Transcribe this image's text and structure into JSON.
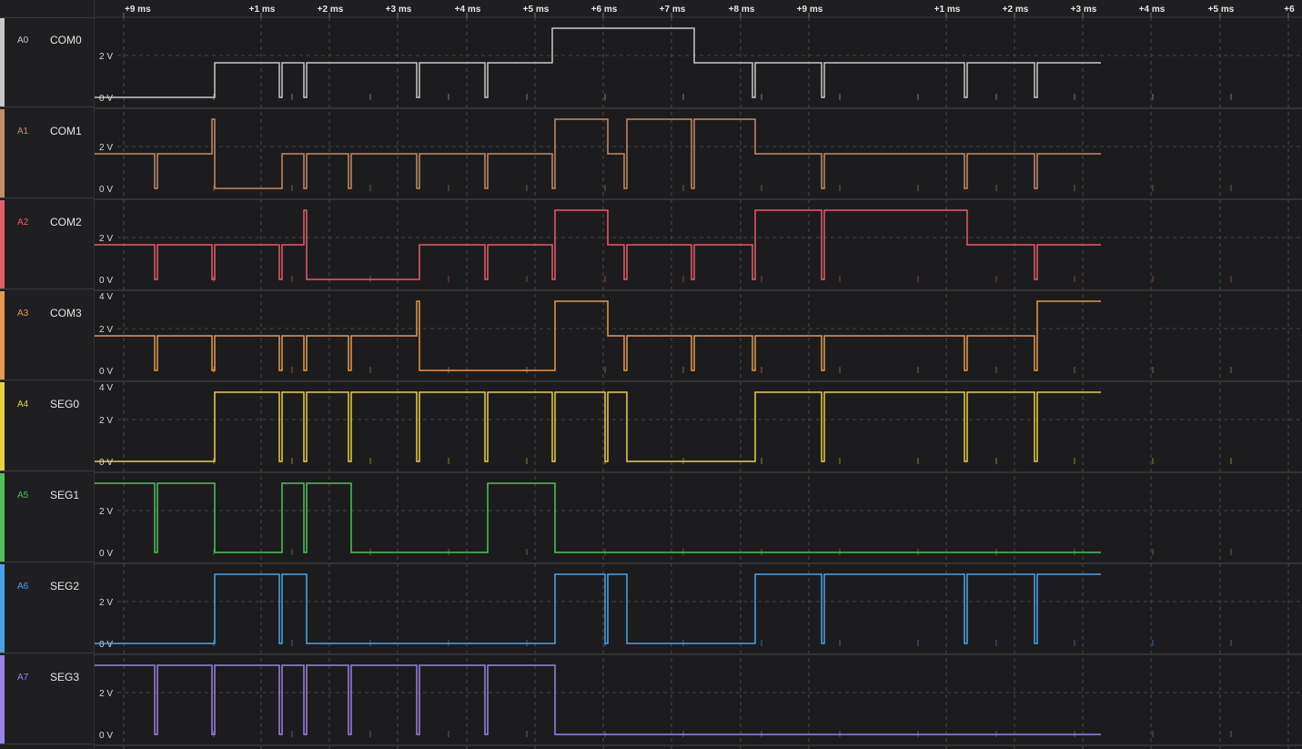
{
  "time_ruler": {
    "ticks": [
      "+9 ms",
      "+1 ms",
      "+2 ms",
      "+3 ms",
      "+4 ms",
      "+5 ms",
      "+6 ms",
      "+7 ms",
      "+8 ms",
      "+9 ms",
      "+1 ms",
      "+2 ms",
      "+3 ms",
      "+4 ms",
      "+5 ms",
      "+6"
    ]
  },
  "channels": [
    {
      "id": "A0",
      "name": "COM0",
      "color": "#c8c8c8",
      "axis": [
        "2 V",
        "0 V"
      ],
      "levels": [
        0,
        0,
        1,
        1,
        1,
        1,
        1,
        1,
        2,
        2,
        2,
        1,
        1,
        1,
        1,
        1
      ],
      "glitch": [
        1,
        1,
        1,
        1,
        1,
        0,
        1,
        1,
        0,
        0,
        0,
        1,
        1,
        1,
        1,
        1
      ]
    },
    {
      "id": "A1",
      "name": "COM1",
      "color": "#c48c6a",
      "axis": [
        "2 V",
        "0 V"
      ],
      "levels": [
        1,
        1,
        0,
        1,
        1,
        1,
        1,
        1,
        2,
        1,
        2,
        2,
        1,
        1,
        1,
        1
      ],
      "glitch": [
        1,
        1,
        1,
        1,
        1,
        1,
        1,
        1,
        1,
        1,
        1,
        1,
        1,
        1,
        1,
        1
      ]
    },
    {
      "id": "A2",
      "name": "COM2",
      "color": "#e35d6a",
      "axis": [
        "2 V",
        "0 V"
      ],
      "levels": [
        1,
        1,
        1,
        1,
        0,
        0,
        1,
        1,
        2,
        1,
        1,
        1,
        2,
        2,
        1,
        1
      ],
      "glitch": [
        1,
        1,
        1,
        1,
        1,
        1,
        1,
        1,
        1,
        1,
        1,
        1,
        1,
        1,
        1,
        1
      ]
    },
    {
      "id": "A3",
      "name": "COM3",
      "color": "#e89a4a",
      "axis": [
        "4 V",
        "2 V",
        "0 V"
      ],
      "levels": [
        1,
        1,
        1,
        1,
        1,
        1,
        0,
        0,
        2,
        1,
        1,
        1,
        1,
        1,
        1,
        2
      ],
      "glitch": [
        1,
        1,
        1,
        1,
        1,
        1,
        1,
        1,
        1,
        1,
        1,
        1,
        1,
        1,
        1,
        1
      ]
    },
    {
      "id": "A4",
      "name": "SEG0",
      "color": "#e8d23a",
      "axis": [
        "4 V",
        "2 V",
        "0 V"
      ],
      "levels": [
        0,
        0,
        2,
        2,
        2,
        2,
        2,
        2,
        2,
        2,
        0,
        0,
        2,
        2,
        2,
        2
      ],
      "glitch": [
        1,
        1,
        1,
        1,
        1,
        1,
        1,
        1,
        1,
        1,
        1,
        1,
        1,
        1,
        1,
        1
      ]
    },
    {
      "id": "A5",
      "name": "SEG1",
      "color": "#4fc15a",
      "axis": [
        "2 V",
        "0 V"
      ],
      "levels": [
        2,
        2,
        0,
        2,
        2,
        0,
        0,
        2,
        0,
        0,
        0,
        0,
        0,
        0,
        0,
        0
      ],
      "glitch": [
        1,
        1,
        1,
        1,
        1,
        1,
        1,
        1,
        1,
        1,
        1,
        1,
        1,
        1,
        1,
        1
      ]
    },
    {
      "id": "A6",
      "name": "SEG2",
      "color": "#4aa3e8",
      "axis": [
        "2 V",
        "0 V"
      ],
      "levels": [
        0,
        0,
        2,
        2,
        0,
        0,
        0,
        0,
        2,
        2,
        0,
        0,
        2,
        2,
        2,
        2
      ],
      "glitch": [
        1,
        1,
        1,
        1,
        1,
        1,
        1,
        1,
        1,
        1,
        1,
        1,
        1,
        1,
        1,
        1
      ]
    },
    {
      "id": "A7",
      "name": "SEG3",
      "color": "#9b82e6",
      "axis": [
        "2 V",
        "0 V"
      ],
      "levels": [
        2,
        2,
        2,
        2,
        2,
        2,
        2,
        2,
        0,
        0,
        0,
        0,
        0,
        0,
        0,
        0
      ],
      "glitch": [
        1,
        1,
        1,
        1,
        1,
        1,
        1,
        1,
        1,
        1,
        1,
        1,
        1,
        1,
        1,
        1
      ]
    }
  ]
}
